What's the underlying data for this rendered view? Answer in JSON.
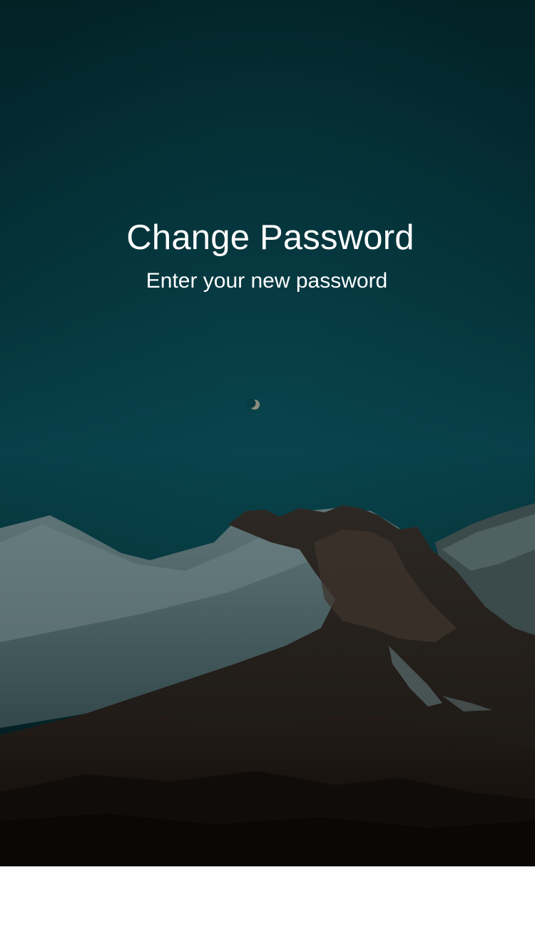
{
  "screen": {
    "title": "Change Password",
    "subtitle": "Enter your new password"
  },
  "background": {
    "image": "night-mountain-landscape",
    "moon_icon": "moon-icon",
    "sky_color": "#05323a",
    "overlay_color": "#022226"
  },
  "colors": {
    "text": "#ffffff",
    "bottom_panel": "#ffffff"
  }
}
